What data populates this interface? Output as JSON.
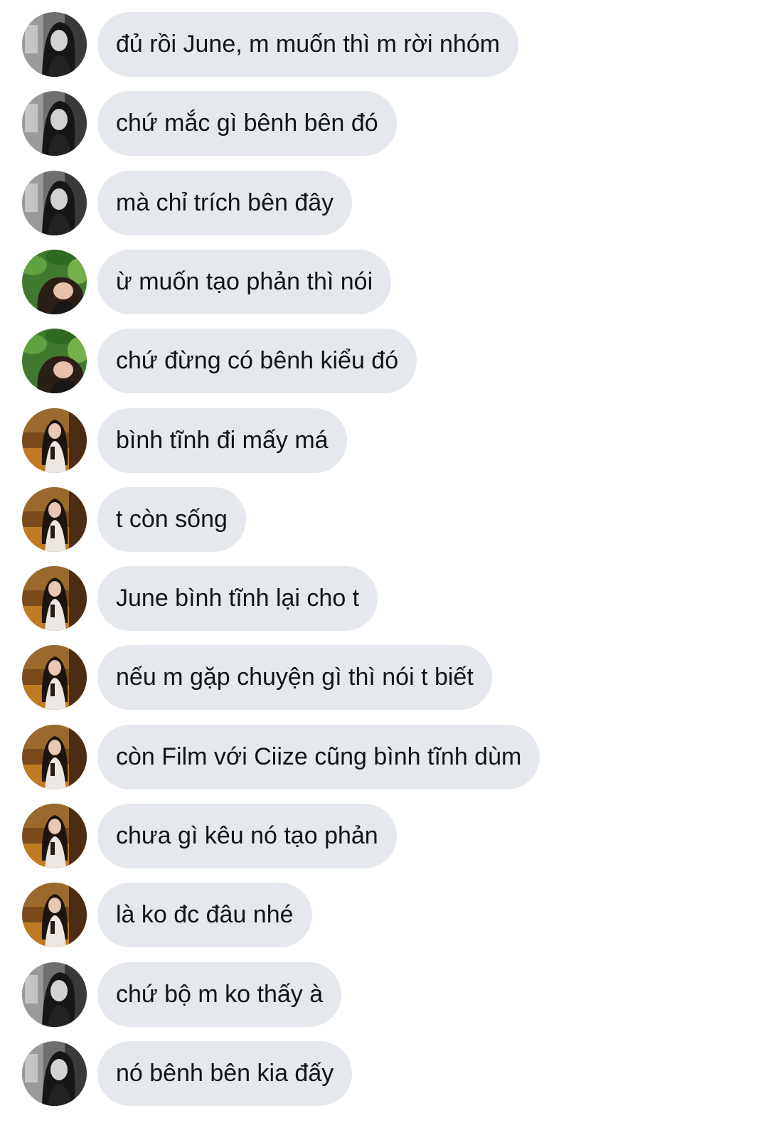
{
  "colors": {
    "bubble_background": "#e5e8ec",
    "bubble_text": "#111418",
    "page_background": "#ffffff"
  },
  "avatar_styles": {
    "bw": "grayscale portrait, dark hair",
    "green": "portrait with green leaves background",
    "warm": "portrait with warm orange-brown background"
  },
  "messages": [
    {
      "avatar": "bw",
      "text": "đủ rồi June, m muốn thì m rời nhóm"
    },
    {
      "avatar": "bw",
      "text": "chứ mắc gì bênh bên đó"
    },
    {
      "avatar": "bw",
      "text": "mà chỉ trích bên đây"
    },
    {
      "avatar": "green",
      "text": "ừ muốn tạo phản thì nói"
    },
    {
      "avatar": "green",
      "text": "chứ đừng có bênh kiểu đó"
    },
    {
      "avatar": "warm",
      "text": "bình tĩnh đi mấy má"
    },
    {
      "avatar": "warm",
      "text": "t còn sống"
    },
    {
      "avatar": "warm",
      "text": "June bình tĩnh lại cho t"
    },
    {
      "avatar": "warm",
      "text": "nếu m gặp chuyện gì thì nói t biết"
    },
    {
      "avatar": "warm",
      "text": "còn Film với Ciize cũng bình tĩnh dùm"
    },
    {
      "avatar": "warm",
      "text": "chưa gì kêu nó tạo phản"
    },
    {
      "avatar": "warm",
      "text": "là ko đc đâu nhé"
    },
    {
      "avatar": "bw",
      "text": "chứ bộ m ko thấy à"
    },
    {
      "avatar": "bw",
      "text": "nó bênh bên kia đấy"
    }
  ]
}
